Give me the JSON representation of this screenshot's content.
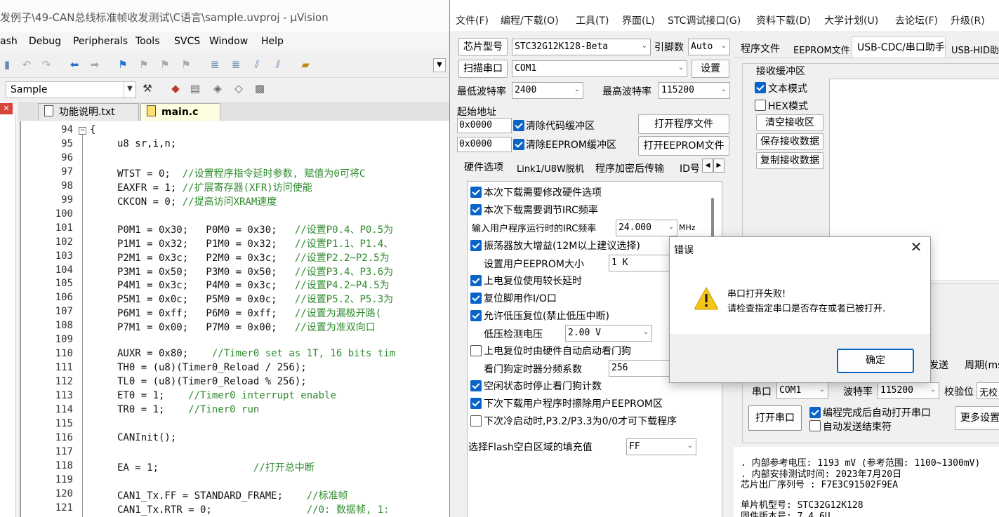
{
  "uvision": {
    "title": "发例子\\49-CAN总线标准帧收发测试\\C语言\\sample.uvproj - µVision",
    "menu": [
      "ash",
      "Debug",
      "Peripherals",
      "Tools",
      "SVCS",
      "Window",
      "Help"
    ],
    "target": "Sample",
    "tabs": [
      "功能说明.txt",
      "main.c"
    ],
    "line_numbers": [
      "94",
      "95",
      "96",
      "97",
      "98",
      "99",
      "100",
      "101",
      "102",
      "103",
      "104",
      "105",
      "106",
      "107",
      "108",
      "109",
      "110",
      "111",
      "112",
      "113",
      "114",
      "115",
      "116",
      "117",
      "118",
      "119",
      "120",
      "121"
    ],
    "code": [
      "{",
      "u8 sr,i,n;",
      "",
      "WTST = 0;  //设置程序指令延时参数, 赋值为0可将C",
      "EAXFR = 1; //扩展寄存器(XFR)访问使能",
      "CKCON = 0; //提高访问XRAM速度",
      "",
      "P0M1 = 0x30;   P0M0 = 0x30;   //设置P0.4、P0.5为",
      "P1M1 = 0x32;   P1M0 = 0x32;   //设置P1.1、P1.4、",
      "P2M1 = 0x3c;   P2M0 = 0x3c;   //设置P2.2~P2.5为",
      "P3M1 = 0x50;   P3M0 = 0x50;   //设置P3.4、P3.6为",
      "P4M1 = 0x3c;   P4M0 = 0x3c;   //设置P4.2~P4.5为",
      "P5M1 = 0x0c;   P5M0 = 0x0c;   //设置P5.2、P5.3为",
      "P6M1 = 0xff;   P6M0 = 0xff;   //设置为漏极开路(",
      "P7M1 = 0x00;   P7M0 = 0x00;   //设置为准双向口",
      "",
      "AUXR = 0x80;    //Timer0 set as 1T, 16 bits tim",
      "TH0 = (u8)(Timer0_Reload / 256);",
      "TL0 = (u8)(Timer0_Reload % 256);",
      "ET0 = 1;    //Timer0 interrupt enable",
      "TR0 = 1;    //Tiner0 run",
      "",
      "CANInit();",
      "",
      "EA = 1;                //打开总中断",
      "",
      "CAN1_Tx.FF = STANDARD_FRAME;    //标准帧",
      "CAN1_Tx.RTR = 0;                //0: 数据帧, 1:"
    ]
  },
  "stc": {
    "menu": [
      "文件(F)",
      "编程/下载(O)",
      "工具(T)",
      "界面(L)",
      "STC调试接口(G)",
      "资料下载(D)",
      "大学计划(U)",
      "去论坛(F)",
      "升级(R)"
    ],
    "chip_type_btn": "芯片型号",
    "chip_type": "STC32G12K128-Beta",
    "pins_label": "引脚数",
    "pins": "Auto",
    "scan_port_btn": "扫描串口",
    "port": "COM1",
    "settings_btn": "设置",
    "min_baud_label": "最低波特率",
    "min_baud": "2400",
    "max_baud_label": "最高波特率",
    "max_baud": "115200",
    "start_addr_label": "起始地址",
    "addr1": "0x0000",
    "clear_code": "清除代码缓冲区",
    "open_prog_btn": "打开程序文件",
    "addr2": "0x0000",
    "clear_eeprom": "清除EEPROM缓冲区",
    "open_eeprom_btn": "打开EEPROM文件",
    "tabs": [
      "硬件选项",
      "Link1/U8W脱机",
      "程序加密后传输",
      "ID号"
    ],
    "options": [
      {
        "label": "本次下载需要修改硬件选项",
        "checked": true
      },
      {
        "label": "本次下载需要调节IRC频率",
        "checked": true
      },
      {
        "label": "输入用户程序运行时的IRC频率",
        "value": "24.000",
        "unit": "MHz"
      },
      {
        "label": "振荡器放大增益(12M以上建议选择)",
        "checked": true
      },
      {
        "label": "设置用户EEPROM大小",
        "value": "1   K"
      },
      {
        "label": "上电复位使用较长延时",
        "checked": true
      },
      {
        "label": "复位脚用作I/O口",
        "checked": true
      },
      {
        "label": "允许低压复位(禁止低压中断)",
        "checked": true
      },
      {
        "label": "低压检测电压",
        "value": "2.00 V"
      },
      {
        "label": "上电复位时由硬件自动启动看门狗",
        "checked": false
      },
      {
        "label": "看门狗定时器分频系数",
        "value": "256"
      },
      {
        "label": "空闲状态时停止看门狗计数",
        "checked": true
      },
      {
        "label": "下次下载用户程序时擦除用户EEPROM区",
        "checked": true
      },
      {
        "label": "下次冷启动时,P3.2/P3.3为0/0才可下载程序",
        "checked": false
      }
    ],
    "flash_fill_label": "选择Flash空白区域的填充值",
    "flash_fill": "FF",
    "right_tabs": [
      "程序文件",
      "EEPROM文件",
      "USB-CDC/串口助手",
      "USB-HID助"
    ],
    "recv_label": "接收缓冲区",
    "text_mode": "文本模式",
    "hex_mode": "HEX模式",
    "clear_recv_btn": "清空接收区",
    "save_recv_btn": "保存接收数据",
    "copy_recv_btn": "复制接收数据",
    "send_label": "发送",
    "period_label": "周期(ms",
    "serial_label": "串口",
    "serial_port": "COM1",
    "baud_label": "波特率",
    "baud": "115200",
    "parity_label": "校验位",
    "parity": "无校",
    "open_serial_btn": "打开串口",
    "auto_open": "编程完成后自动打开串口",
    "auto_send_end": "自动发送结束符",
    "more_settings_btn": "更多设置",
    "info": [
      ". 内部参考电压: 1193 mV (参考范围: 1100~1300mV)",
      ". 内部安排测试时间: 2023年7月20日",
      "芯片出厂序列号 : F7E3C91502F9EA",
      "",
      "单片机型号: STC32G12K128",
      "固件版本号: 7.4.6U"
    ]
  },
  "dialog": {
    "title": "错误",
    "message_line1": "串口打开失败!",
    "message_line2": "请检查指定串口是否存在或者已被打开.",
    "ok": "确定"
  }
}
